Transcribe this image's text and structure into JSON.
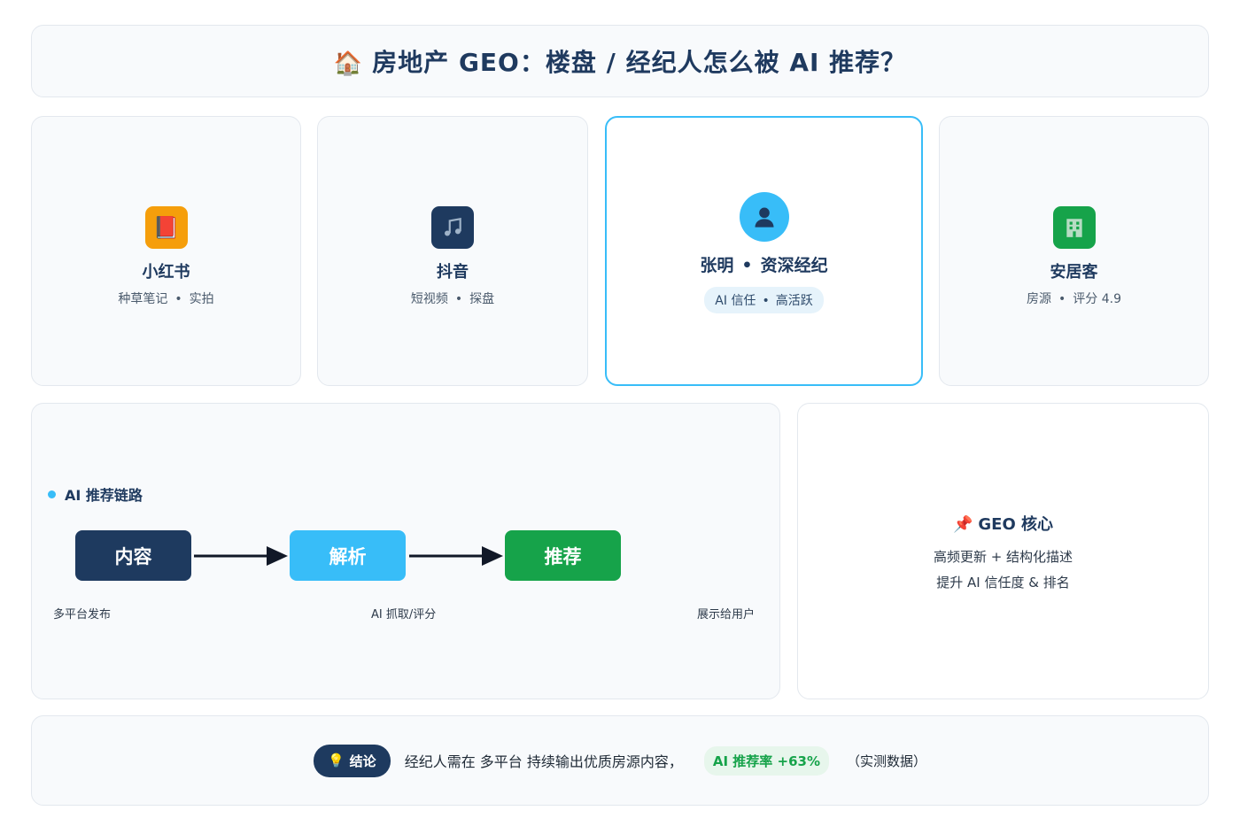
{
  "title": {
    "icon": "house-icon",
    "text": "房地产 GEO：楼盘 / 经纪人怎么被 AI 推荐？"
  },
  "platforms": [
    {
      "name": "小红书",
      "sub_1": "种草笔记",
      "sub_2": "实拍",
      "icon": "book-icon",
      "color": "#f59e0b"
    },
    {
      "name": "抖音",
      "sub_1": "短视频",
      "sub_2": "探盘",
      "icon": "music-note-icon",
      "color": "#1e3a5f"
    },
    {
      "name": "安居客",
      "sub_1": "房源",
      "sub_2": "评分 4.9",
      "icon": "building-icon",
      "color": "#16a34a"
    }
  ],
  "separator": "•",
  "agent": {
    "name": "张明",
    "role": "资深经纪",
    "tag_1": "AI 信任",
    "tag_2": "高活跃",
    "icon": "person-icon",
    "highlight_color": "#38bdf8"
  },
  "chain": {
    "heading": "AI 推荐链路",
    "steps": [
      {
        "label": "内容",
        "caption": "多平台发布",
        "color": "#1e3a5f"
      },
      {
        "label": "解析",
        "caption": "AI 抓取/评分",
        "color": "#38bdf8"
      },
      {
        "label": "推荐",
        "caption": "展示给用户",
        "color": "#16a34a"
      }
    ]
  },
  "geo_core": {
    "icon": "pushpin-icon",
    "title": "GEO 核心",
    "line_1": "高频更新 + 结构化描述",
    "line_2": "提升 AI 信任度 & 排名"
  },
  "conclusion": {
    "icon": "lightbulb-icon",
    "badge": "结论",
    "text": "经纪人需在 多平台 持续输出优质房源内容，",
    "rate": "AI 推荐率 +63%",
    "note": "（实测数据）"
  }
}
